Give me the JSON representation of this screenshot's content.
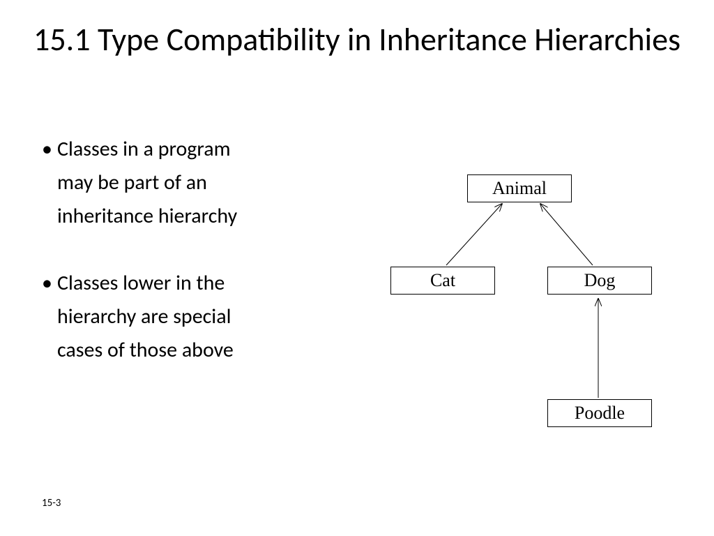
{
  "title": "15.1 Type Compatibility in Inheritance Hierarchies",
  "bullets": [
    {
      "lines": [
        "Classes in a program",
        "may be part of an",
        "inheritance hierarchy"
      ]
    },
    {
      "lines": [
        "Classes lower in the",
        "hierarchy are special",
        "cases of those above"
      ]
    }
  ],
  "diagram": {
    "nodes": {
      "animal": "Animal",
      "cat": "Cat",
      "dog": "Dog",
      "poodle": "Poodle"
    }
  },
  "page_number": "15-3"
}
